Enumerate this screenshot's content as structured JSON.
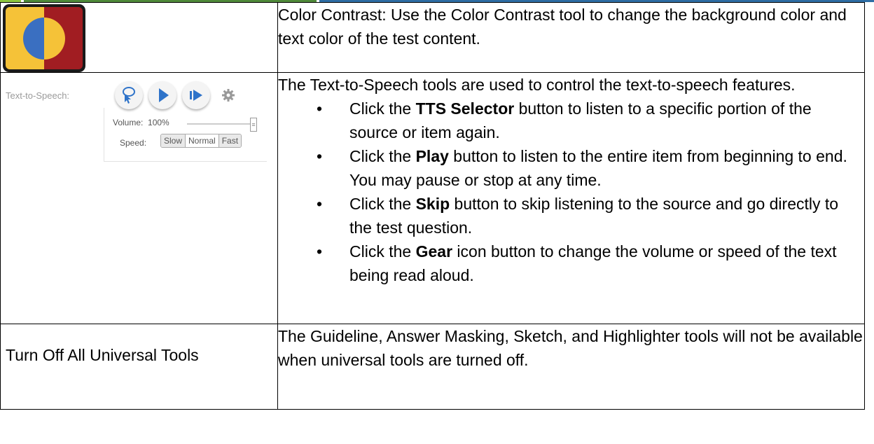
{
  "rows": [
    {
      "text": "Color Contrast: Use the Color Contrast tool to change the background color and text color of the test content."
    },
    {
      "intro": "The Text-to-Speech tools are used to control the text-to-speech features.",
      "bullets": [
        {
          "pre": "Click the ",
          "bold": "TTS Selector",
          "post": " button to listen to a specific portion of the source or item again."
        },
        {
          "pre": "Click the ",
          "bold": "Play",
          "post": " button to listen to the entire item from beginning to end. You may pause or stop at any time."
        },
        {
          "pre": "Click the ",
          "bold": "Skip",
          "post": " button to skip listening to the source and go directly to the test question."
        },
        {
          "pre": "Click the ",
          "bold": "Gear",
          "post": " icon button to change the volume or speed of the text being read aloud."
        }
      ]
    },
    {
      "label": "Turn Off All Universal Tools",
      "text": "The Guideline, Answer Masking, Sketch, and Highlighter tools will not be available when universal tools are turned off."
    }
  ],
  "tts_widget": {
    "label": "Text-to-Speech:",
    "volume_label": "Volume:",
    "volume_value": "100%",
    "volume_level": 1.0,
    "speed_label": "Speed:",
    "speed_options": [
      "Slow",
      "Normal",
      "Fast"
    ],
    "speed_selected": "Normal",
    "icons": [
      "tts-selector-icon",
      "play-icon",
      "skip-icon",
      "gear-icon"
    ]
  },
  "colors": {
    "contrast_yellow": "#f5c238",
    "contrast_red": "#a11d22",
    "contrast_blue": "#3a6fc1",
    "tts_blue": "#2e73c9"
  }
}
